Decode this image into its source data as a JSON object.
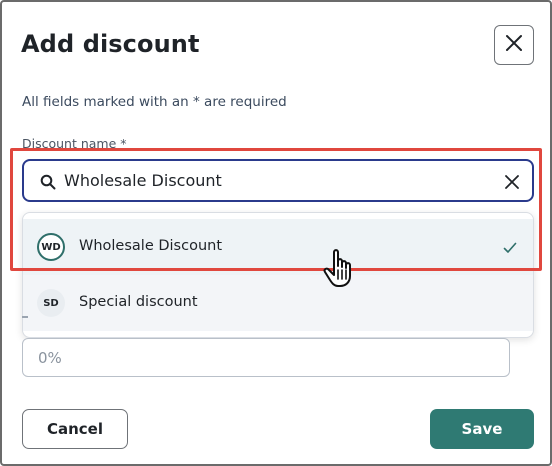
{
  "dialog": {
    "title": "Add discount",
    "required_note": "All fields marked with an * are required",
    "close_icon": "close-icon"
  },
  "discount_name": {
    "label": "Discount name *",
    "value": "Wholesale Discount",
    "search_icon": "search-icon",
    "clear_icon": "clear-icon"
  },
  "dropdown": {
    "options": [
      {
        "initials": "WD",
        "label": "Wholesale Discount",
        "selected": true
      },
      {
        "initials": "SD",
        "label": "Special discount",
        "selected": false
      }
    ]
  },
  "percentage": {
    "placeholder": "0%"
  },
  "footer": {
    "cancel_label": "Cancel",
    "save_label": "Save"
  },
  "colors": {
    "accent": "#2f7a73",
    "focus_border": "#2a3a8c",
    "highlight": "#e0473e"
  }
}
